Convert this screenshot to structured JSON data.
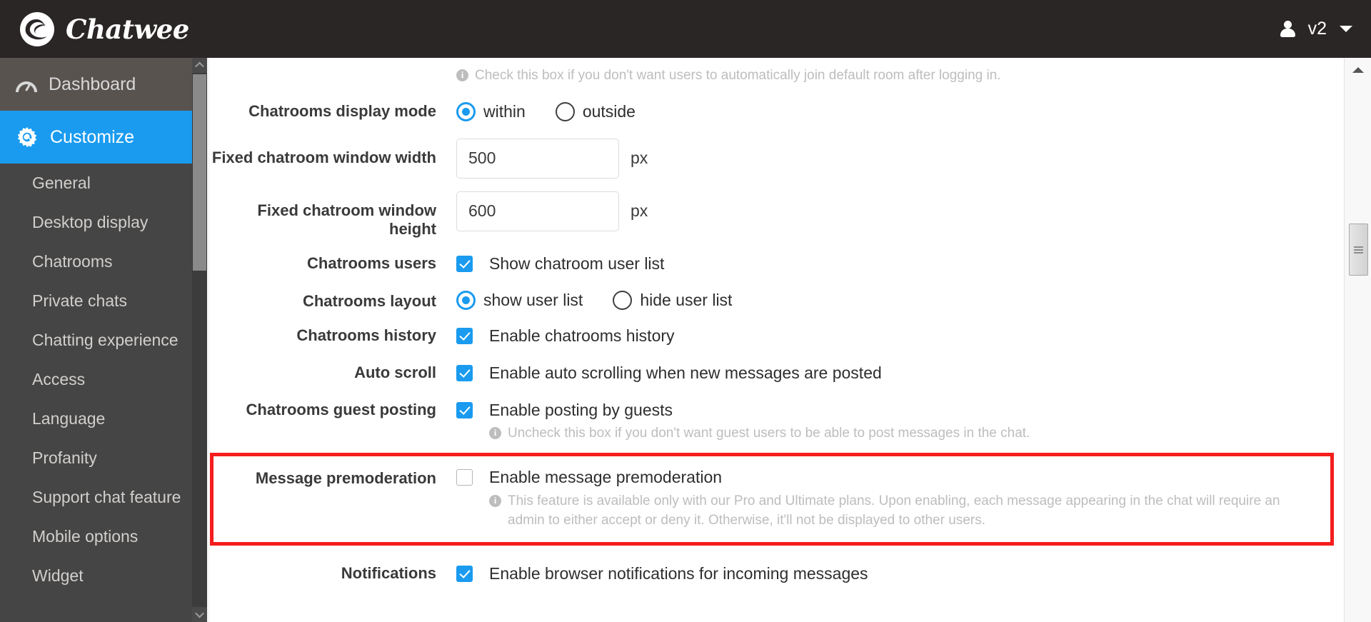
{
  "topbar": {
    "logo_text": "Chatwee",
    "logo_icon": "chatwee-swirl-icon",
    "user_icon": "user-avatar-icon",
    "version_label": "v2",
    "caret_icon": "chevron-down-icon"
  },
  "sidebar": {
    "primary": [
      {
        "label": "Dashboard",
        "icon": "gauge-icon",
        "active": false
      },
      {
        "label": "Customize",
        "icon": "gear-icon",
        "active": true
      }
    ],
    "sub_items": [
      {
        "label": "General"
      },
      {
        "label": "Desktop display"
      },
      {
        "label": "Chatrooms"
      },
      {
        "label": "Private chats"
      },
      {
        "label": "Chatting experience"
      },
      {
        "label": "Access"
      },
      {
        "label": "Language"
      },
      {
        "label": "Profanity"
      },
      {
        "label": "Support chat feature"
      },
      {
        "label": "Mobile options"
      },
      {
        "label": "Widget"
      }
    ],
    "scroll_up_icon": "chevron-up-icon",
    "scroll_down_icon": "chevron-down-icon"
  },
  "content": {
    "top_help": "Check this box if you don't want users to automatically join default room after logging in.",
    "rows": {
      "display_mode": {
        "label": "Chatrooms display mode",
        "options": [
          {
            "label": "within",
            "selected": true
          },
          {
            "label": "outside",
            "selected": false
          }
        ]
      },
      "window_width": {
        "label": "Fixed chatroom window width",
        "value": "500",
        "unit": "px"
      },
      "window_height": {
        "label": "Fixed chatroom window height",
        "value": "600",
        "unit": "px"
      },
      "users": {
        "label": "Chatrooms users",
        "checkbox_label": "Show chatroom user list",
        "checked": true
      },
      "layout": {
        "label": "Chatrooms layout",
        "options": [
          {
            "label": "show user list",
            "selected": true
          },
          {
            "label": "hide user list",
            "selected": false
          }
        ]
      },
      "history": {
        "label": "Chatrooms history",
        "checkbox_label": "Enable chatrooms history",
        "checked": true
      },
      "auto_scroll": {
        "label": "Auto scroll",
        "checkbox_label": "Enable auto scrolling when new messages are posted",
        "checked": true
      },
      "guest_posting": {
        "label": "Chatrooms guest posting",
        "checkbox_label": "Enable posting by guests",
        "checked": true,
        "help": "Uncheck this box if you don't want guest users to be able to post messages in the chat."
      },
      "premoderation": {
        "label": "Message premoderation",
        "checkbox_label": "Enable message premoderation",
        "checked": false,
        "help": "This feature is available only with our Pro and Ultimate plans. Upon enabling, each message appearing in the chat will require an admin to either accept or deny it. Otherwise, it'll not be displayed to other users.",
        "highlight_color": "#f51d1d"
      },
      "notifications": {
        "label": "Notifications",
        "checkbox_label": "Enable browser notifications for incoming messages",
        "checked": true
      }
    }
  },
  "colors": {
    "accent": "#1a9bf0",
    "topbar_bg": "#2b2626",
    "sidebar_bg": "#454545",
    "highlight": "#f51d1d"
  }
}
